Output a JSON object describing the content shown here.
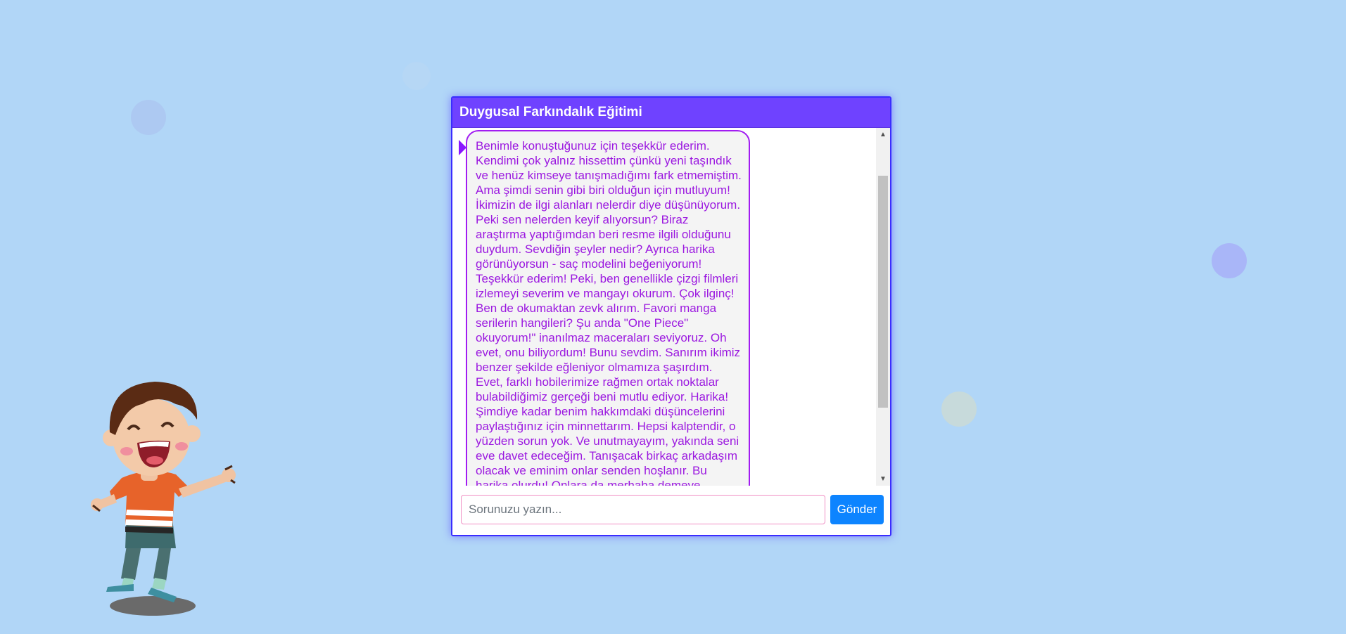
{
  "chat": {
    "title": "Duygusal Farkındalık Eğitimi",
    "message": "Benimle konuştuğunuz için teşekkür ederim. Kendimi çok yalnız hissettim çünkü yeni taşındık ve henüz kimseye tanışmadığımı fark etmemiştim. Ama şimdi senin gibi biri olduğun için mutluyum! İkimizin de ilgi alanları nelerdir diye düşünüyorum. Peki sen nelerden keyif alıyorsun? Biraz araştırma yaptığımdan beri resme ilgili olduğunu duydum. Sevdiğin şeyler nedir? Ayrıca harika görünüyorsun - saç modelini beğeniyorum! Teşekkür ederim! Peki, ben genellikle çizgi filmleri izlemeyi severim ve mangayı okurum. Çok ilginç! Ben de okumaktan zevk alırım. Favori manga serilerin hangileri? Şu anda \"One Piece\" okuyorum!\" inanılmaz maceraları seviyoruz. Oh evet, onu biliyordum! Bunu sevdim. Sanırım ikimiz benzer şekilde eğleniyor olmamıza şaşırdım. Evet, farklı hobilerimize rağmen ortak noktalar bulabildiğimiz gerçeği beni mutlu ediyor. Harika! Şimdiye kadar benim hakkımdaki düşüncelerini paylaştığınız için minnettarım. Hepsi kalptendir, o yüzden sorun yok. Ve unutmayayım, yakında seni eve davet edeceğim. Tanışacak birkaç arkadaşım olacak ve eminim onlar senden hoşlanır. Bu harika olurdu! Onlara da merhaba demeye hazırım. Yapmalısın!",
    "input_placeholder": "Sorunuzu yazın...",
    "input_value": "",
    "send_label": "Gönder"
  },
  "colors": {
    "background": "#b1d6f7",
    "header": "#6f42ff",
    "message_text": "#9b18e0",
    "send_button": "#0d84ff"
  },
  "icons": {
    "scroll_up": "triangle-up",
    "scroll_down": "triangle-down",
    "illustration": "happy-boy-illustration"
  }
}
